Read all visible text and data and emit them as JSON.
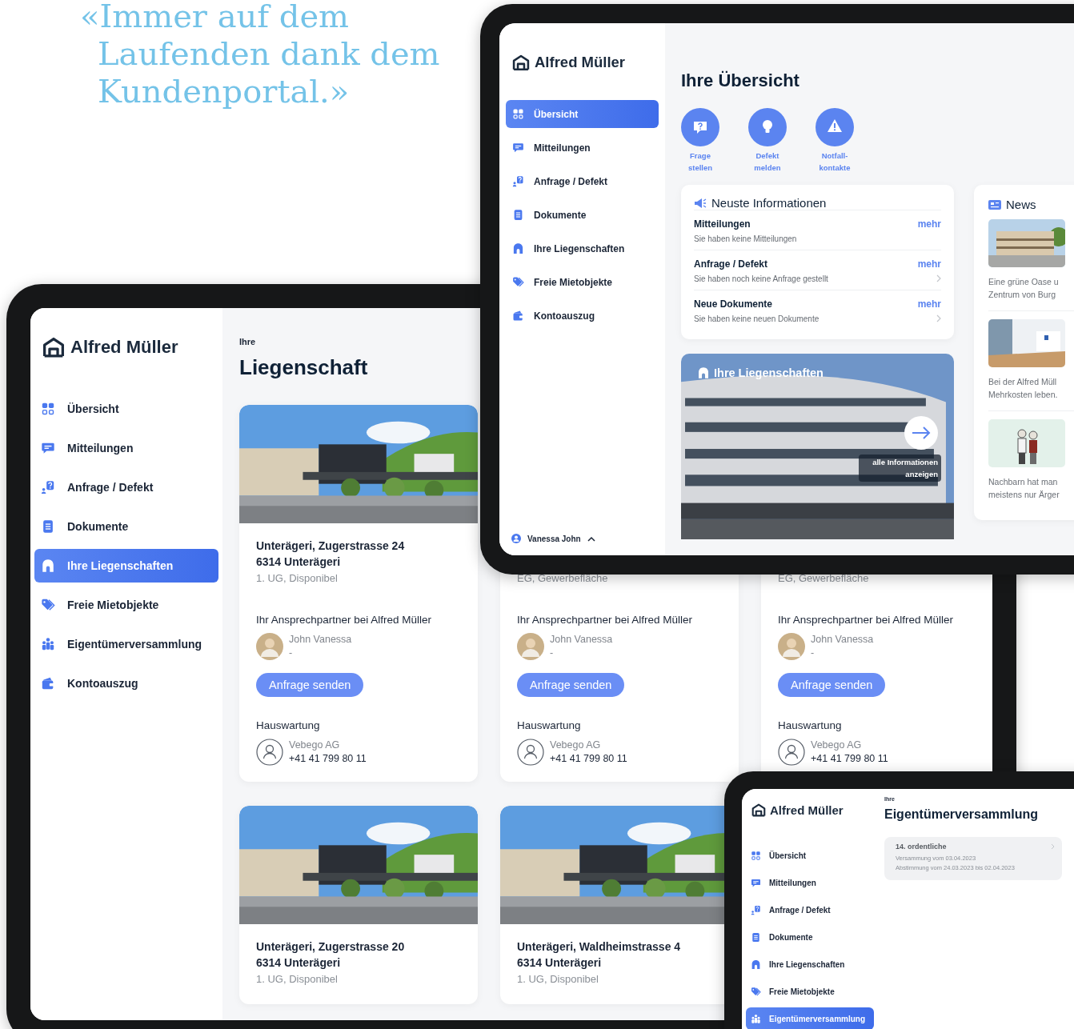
{
  "quote": {
    "lines": [
      "«Immer auf dem",
      "Laufenden dank dem",
      "Kundenportal.»"
    ]
  },
  "overview_tablet": {
    "sidebar": {
      "logo": "Alfred Müller",
      "items": [
        {
          "label": "Übersicht",
          "kind": "overview",
          "selected": true
        },
        {
          "label": "Mitteilungen",
          "kind": "messages",
          "selected": false
        },
        {
          "label": "Anfrage / Defekt",
          "kind": "request",
          "selected": false
        },
        {
          "label": "Dokumente",
          "kind": "documents",
          "selected": false
        },
        {
          "label": "Ihre Liegenschaften",
          "kind": "properties",
          "selected": false
        },
        {
          "label": "Freie Mietobjekte",
          "kind": "rentals",
          "selected": false
        },
        {
          "label": "Kontoauszug",
          "kind": "account",
          "selected": false
        }
      ],
      "user": "Vanessa John"
    },
    "title": "Ihre Übersicht",
    "actions": [
      {
        "label": "Frage stellen",
        "kind": "question"
      },
      {
        "label": "Defekt melden",
        "kind": "defect"
      },
      {
        "label": "Notfall-kontakte",
        "kind": "emergency"
      }
    ],
    "info": {
      "title": "Neuste Informationen",
      "rows": [
        {
          "title": "Mitteilungen",
          "text": "Sie haben keine Mitteilungen",
          "link": "mehr",
          "chevron": false
        },
        {
          "title": "Anfrage / Defekt",
          "text": "Sie haben noch keine Anfrage gestellt",
          "link": "mehr",
          "chevron": true
        },
        {
          "title": "Neue Dokumente",
          "text": "Sie haben keine neuen Dokumente",
          "link": "mehr",
          "chevron": true
        }
      ]
    },
    "news": {
      "title": "News",
      "items": [
        {
          "media": {
            "kind": "picture"
          },
          "caption": [
            "Eine grüne Oase u",
            "Zentrum von Burg"
          ]
        },
        {
          "media": {
            "kind": "picture"
          },
          "caption": [
            "Bei der Alfred Müll",
            "Mehrkosten leben."
          ]
        },
        {
          "media": {
            "kind": "picture"
          },
          "caption": [
            "Nachbarn hat man",
            "meistens nur Ärger"
          ]
        }
      ]
    },
    "teaser": {
      "media": {
        "kind": "picture"
      },
      "title": "Ihre Liegenschaften",
      "link": "alle Informationen anzeigen"
    }
  },
  "properties_tablet": {
    "sidebar": {
      "logo": "Alfred Müller",
      "items": [
        {
          "label": "Übersicht",
          "kind": "overview",
          "selected": false
        },
        {
          "label": "Mitteilungen",
          "kind": "messages",
          "selected": false
        },
        {
          "label": "Anfrage / Defekt",
          "kind": "request",
          "selected": false
        },
        {
          "label": "Dokumente",
          "kind": "documents",
          "selected": false
        },
        {
          "label": "Ihre Liegenschaften",
          "kind": "properties",
          "selected": true
        },
        {
          "label": "Freie Mietobjekte",
          "kind": "rentals",
          "selected": false
        },
        {
          "label": "Eigentümerversammlung",
          "kind": "assembly",
          "selected": false
        },
        {
          "label": "Kontoauszug",
          "kind": "account",
          "selected": false
        }
      ]
    },
    "eyebrow": "Ihre",
    "title": "Liegenschaft",
    "cards": [
      {
        "media": {
          "kind": "picture"
        },
        "address": [
          "Unterägeri, Zugerstrasse 24",
          "6314 Unterägeri"
        ],
        "detail": "1. UG, Disponibel",
        "contact_heading": "Ihr Ansprechpartner bei Alfred Müller",
        "contact_name": "John Vanessa",
        "contact_role": "-",
        "button": "Anfrage senden",
        "service_heading": "Hauswartung",
        "service_name": "Vebego AG",
        "service_phone": "+41 41 799 80 11"
      },
      {
        "detail": "EG, Gewerbefläche",
        "contact_heading": "Ihr Ansprechpartner bei Alfred Müller",
        "contact_name": "John Vanessa",
        "contact_role": "-",
        "button": "Anfrage senden",
        "service_heading": "Hauswartung",
        "service_name": "Vebego AG",
        "service_phone": "+41 41 799 80 11"
      },
      {
        "detail": "EG, Gewerbefläche",
        "contact_heading": "Ihr Ansprechpartner bei Alfred Müller",
        "contact_name": "John Vanessa",
        "contact_role": "-",
        "button": "Anfrage senden",
        "service_heading": "Hauswartung",
        "service_name": "Vebego AG",
        "service_phone": "+41 41 799 80 11"
      },
      {
        "media": {
          "kind": "picture"
        },
        "address": [
          "Unterägeri, Zugerstrasse 20",
          "6314 Unterägeri"
        ],
        "detail": "1. UG, Disponibel"
      },
      {
        "media": {
          "kind": "picture"
        },
        "address": [
          "Unterägeri, Waldheimstrasse 4",
          "6314 Unterägeri"
        ],
        "detail": "1. UG, Disponibel"
      }
    ]
  },
  "assembly_tablet": {
    "sidebar": {
      "logo": "Alfred Müller",
      "items": [
        {
          "label": "Übersicht",
          "kind": "overview",
          "selected": false
        },
        {
          "label": "Mitteilungen",
          "kind": "messages",
          "selected": false
        },
        {
          "label": "Anfrage / Defekt",
          "kind": "request",
          "selected": false
        },
        {
          "label": "Dokumente",
          "kind": "documents",
          "selected": false
        },
        {
          "label": "Ihre Liegenschaften",
          "kind": "properties",
          "selected": false
        },
        {
          "label": "Freie Mietobjekte",
          "kind": "rentals",
          "selected": false
        },
        {
          "label": "Eigentümerversammlung",
          "kind": "assembly",
          "selected": true
        }
      ]
    },
    "eyebrow": "Ihre",
    "title": "Eigentümerversammlung",
    "entries": [
      {
        "title": "14. ordentliche",
        "lines": [
          "Versammung vom 03.04.2023",
          "Abstimmung vom 24.03.2023 bis 02.04.2023"
        ]
      }
    ]
  }
}
